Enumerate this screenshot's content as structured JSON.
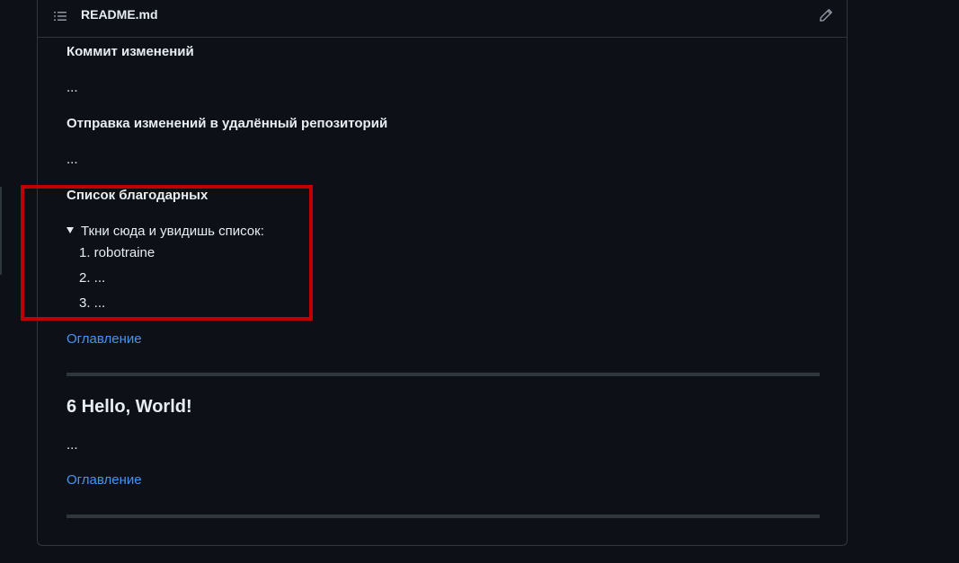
{
  "readme": {
    "file_name": "README.md",
    "sections": {
      "commit_heading": "Коммит изменений",
      "commit_text": "...",
      "push_heading": "Отправка изменений в удалённый репозиторий",
      "push_text": "...",
      "thanks_heading": "Список благодарных",
      "details_summary": "Ткни сюда и увидишь список:",
      "thanks_list": [
        "1. robotraine",
        "2. ...",
        "3. ..."
      ],
      "toc_link_1": "Оглавление",
      "hello_heading": "6 Hello, World!",
      "hello_text": "...",
      "toc_link_2": "Оглавление"
    }
  },
  "icons": {
    "toc": "list-unordered-icon",
    "edit": "pencil-icon"
  },
  "colors": {
    "background": "#0d1117",
    "text": "#e6edf3",
    "link": "#4493f8",
    "border": "#30363d",
    "highlight": "#c00000"
  }
}
